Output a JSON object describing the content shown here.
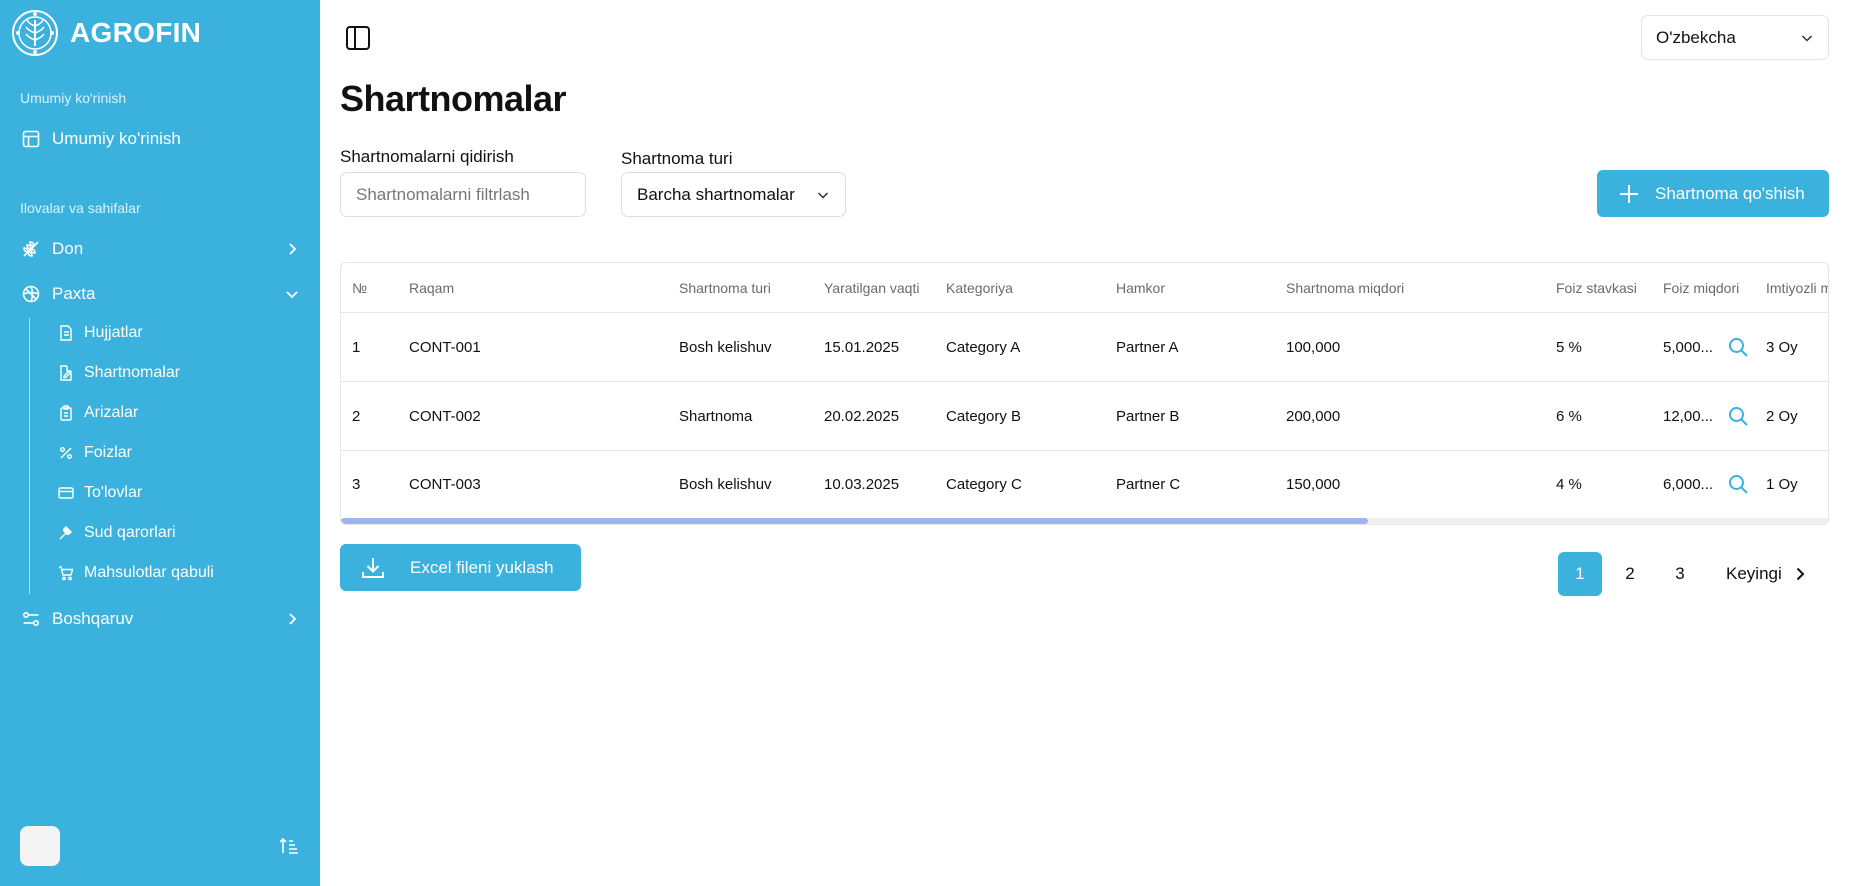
{
  "brand": {
    "name": "AGROFIN"
  },
  "sidebar": {
    "section_overview": "Umumiy ko'rinish",
    "overview_item": "Umumiy ko'rinish",
    "section_apps": "Ilovalar va sahifalar",
    "don": "Don",
    "paxta": "Paxta",
    "sub": [
      "Hujjatlar",
      "Shartnomalar",
      "Arizalar",
      "Foizlar",
      "To'lovlar",
      "Sud qarorlari",
      "Mahsulotlar qabuli"
    ],
    "boshqaruv": "Boshqaruv"
  },
  "header": {
    "language": "O'zbekcha"
  },
  "page": {
    "title": "Shartnomalar"
  },
  "filters": {
    "search_label": "Shartnomalarni qidirish",
    "search_placeholder": "Shartnomalarni filtrlash",
    "type_label": "Shartnoma turi",
    "type_value": "Barcha shartnomalar"
  },
  "actions": {
    "add_label": "Shartnoma qo'shish",
    "excel_label": "Excel fileni yuklash"
  },
  "table": {
    "columns": [
      "№",
      "Raqam",
      "Shartnoma turi",
      "Yaratilgan vaqti",
      "Kategoriya",
      "Hamkor",
      "Shartnoma miqdori",
      "Foiz stavkasi",
      "Foiz miqdori",
      "Imtiyozli m"
    ],
    "rows": [
      [
        "1",
        "CONT-001",
        "Bosh kelishuv",
        "15.01.2025",
        "Category A",
        "Partner A",
        "100,000",
        "5 %",
        "5,000...",
        "3 Oy"
      ],
      [
        "2",
        "CONT-002",
        "Shartnoma",
        "20.02.2025",
        "Category B",
        "Partner B",
        "200,000",
        "6 %",
        "12,00...",
        "2 Oy"
      ],
      [
        "3",
        "CONT-003",
        "Bosh kelishuv",
        "10.03.2025",
        "Category C",
        "Partner C",
        "150,000",
        "4 %",
        "6,000...",
        "1 Oy"
      ]
    ]
  },
  "pagination": {
    "pages": [
      "1",
      "2",
      "3"
    ],
    "next": "Keyingi"
  },
  "colors": {
    "accent": "#3bb1dd",
    "scroll_thumb": "#9db4ee"
  }
}
